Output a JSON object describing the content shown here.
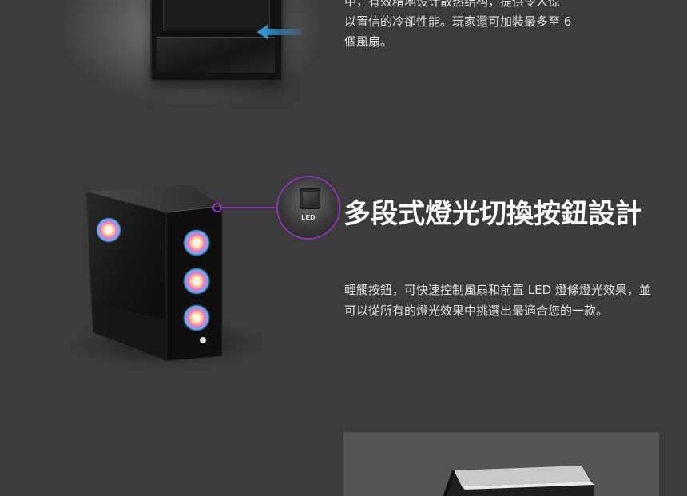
{
  "section1": {
    "text": "中，有效精地设计散热结构，提供令人惊\n以置信的冷卻性能。玩家還可加裝最多至 6\n個風扇。"
  },
  "section2": {
    "callout_label": "LED",
    "title": "多段式燈光切換按鈕設計",
    "body": "輕觸按鈕，可快速控制風扇和前置 LED 燈條燈光效果，並可以從所有的燈光效果中挑選出最適合您的一款。"
  },
  "colors": {
    "background": "#3b3b3b",
    "accent_purple": "#8c33b5",
    "panel_gray": "#545454",
    "arrow_blue": "#3aa7e6"
  }
}
